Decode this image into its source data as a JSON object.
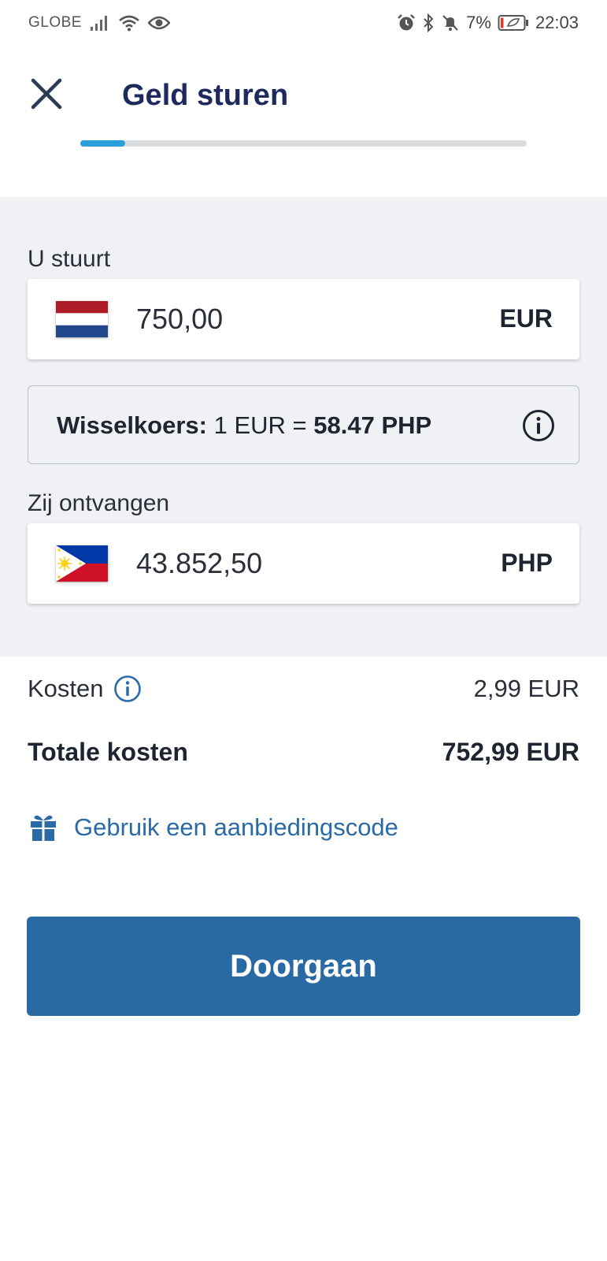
{
  "status_bar": {
    "carrier": "GLOBE",
    "battery": "7%",
    "time": "22:03",
    "icons": [
      "signal-icon",
      "wifi-icon",
      "eye-icon",
      "alarm-icon",
      "bluetooth-icon",
      "mute-icon",
      "battery-icon"
    ]
  },
  "header": {
    "title": "Geld sturen",
    "close_icon": "close-icon",
    "progress_fraction": 0.1
  },
  "send": {
    "label": "U stuurt",
    "amount": "750,00",
    "currency": "EUR",
    "flag": "netherlands-flag"
  },
  "rate": {
    "label": "Wisselkoers:",
    "from": "1 EUR =",
    "to": "58.47 PHP",
    "info_icon": "info-icon"
  },
  "receive": {
    "label": "Zij ontvangen",
    "amount": "43.852,50",
    "currency": "PHP",
    "flag": "philippines-flag"
  },
  "costs": {
    "fee_label": "Kosten",
    "fee_value": "2,99 EUR",
    "total_label": "Totale kosten",
    "total_value": "752,99 EUR"
  },
  "promo": {
    "label": "Gebruik een aanbiedingscode",
    "icon": "gift-icon"
  },
  "actions": {
    "continue_label": "Doorgaan"
  },
  "colors": {
    "title": "#1e2a5e",
    "progress": "#2b9fd9",
    "panel_bg": "#eff1f5",
    "link": "#2a6aa6",
    "primary_button": "#2a6aa4"
  }
}
